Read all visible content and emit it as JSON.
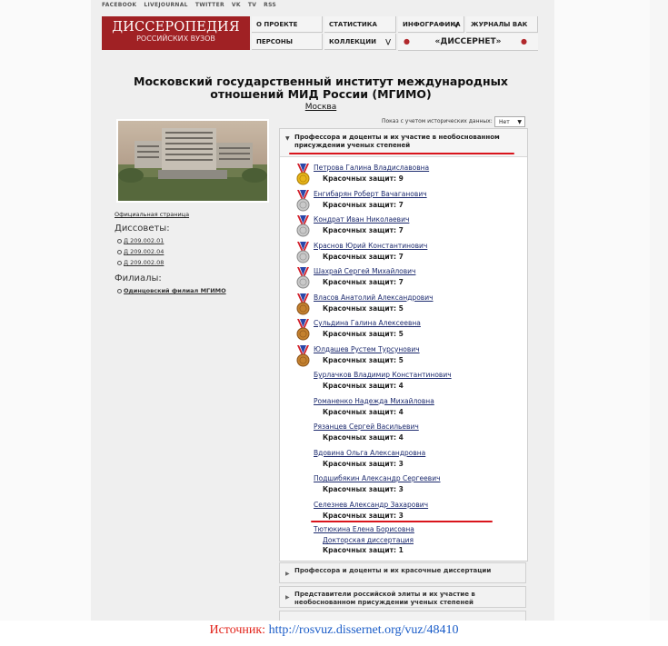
{
  "social_links": [
    "FACEBOOK",
    "LIVEJOURNAL",
    "TWITTER",
    "VK",
    "TV",
    "RSS"
  ],
  "logo": {
    "title": "ДИССЕРОПЕДИЯ",
    "subtitle": "РОССИЙСКИХ ВУЗОВ"
  },
  "nav": {
    "about": "О ПРОЕКТЕ",
    "stats": "СТАТИСТИКА",
    "infographics": "ИНФОГРАФИКА",
    "vak": "ЖУРНАЛЫ ВАК",
    "persons": "ПЕРСОНЫ",
    "collections": "КОЛЛЕКЦИИ",
    "dissernet": "«ДИССЕРНЕТ»"
  },
  "university": {
    "title": "Московский государственный институт международных отношений МИД России (МГИМО)",
    "city": "Москва"
  },
  "historical": {
    "label": "Показ с учетом исторических данных:",
    "value": "Нет"
  },
  "sidebar": {
    "official_page": "Официальная страница",
    "dissovets_title": "Диссоветы:",
    "dissovets": [
      "Д 209.002.01",
      "Д 209.002.04",
      "Д 209.002.08"
    ],
    "filials_title": "Филиалы:",
    "filials": [
      "Одинцовский филиал МГИМО"
    ]
  },
  "panel": {
    "title": "Профессора и доценты и их участие в необоснованном присуждении ученых степеней",
    "people": [
      {
        "name": "Петрова Галина Владиславовна",
        "score": "Красочных защит: 9",
        "medal": "gold"
      },
      {
        "name": "Енгибарян Роберт Вачаганович",
        "score": "Красочных защит: 7",
        "medal": "silver"
      },
      {
        "name": "Кондрат Иван Николаевич",
        "score": "Красочных защит: 7",
        "medal": "silver"
      },
      {
        "name": "Краснов Юрий Константинович",
        "score": "Красочных защит: 7",
        "medal": "silver"
      },
      {
        "name": "Шахрай Сергей Михайлович",
        "score": "Красочных защит: 7",
        "medal": "silver"
      },
      {
        "name": "Власов Анатолий Александрович",
        "score": "Красочных защит: 5",
        "medal": "bronze"
      },
      {
        "name": "Сульдина Галина Алексеевна",
        "score": "Красочных защит: 5",
        "medal": "bronze"
      },
      {
        "name": "Юлдашев Рустем Турсунович",
        "score": "Красочных защит: 5",
        "medal": "bronze"
      },
      {
        "name": "Бурлачков Владимир Константинович",
        "score": "Красочных защит: 4",
        "medal": "none"
      },
      {
        "name": "Романенко Надежда Михайловна",
        "score": "Красочных защит: 4",
        "medal": "none"
      },
      {
        "name": "Рязанцев Сергей Васильевич",
        "score": "Красочных защит: 4",
        "medal": "none"
      },
      {
        "name": "Вдовина Ольга Александровна",
        "score": "Красочных защит: 3",
        "medal": "none"
      },
      {
        "name": "Подшибякин Александр Сергеевич",
        "score": "Красочных защит: 3",
        "medal": "none"
      },
      {
        "name": "Селезнев Александр Захарович",
        "score": "Красочных защит: 3",
        "medal": "none"
      }
    ],
    "last_person": {
      "name": "Тютюкина Елена Борисовна",
      "doctoral": "Докторская диссертация",
      "score": "Красочных защит: 1"
    }
  },
  "collapsed_sections": [
    "Профессора и доценты и их красочные диссертации",
    "Представители российской элиты и их участие в необоснованном присуждении ученых степеней"
  ],
  "source": {
    "label": "Источник:",
    "url": "http://rosvuz.dissernet.org/vuz/48410"
  },
  "colors": {
    "brand": "#a02124",
    "highlight": "#d9141c",
    "link": "#1c2a6e"
  }
}
